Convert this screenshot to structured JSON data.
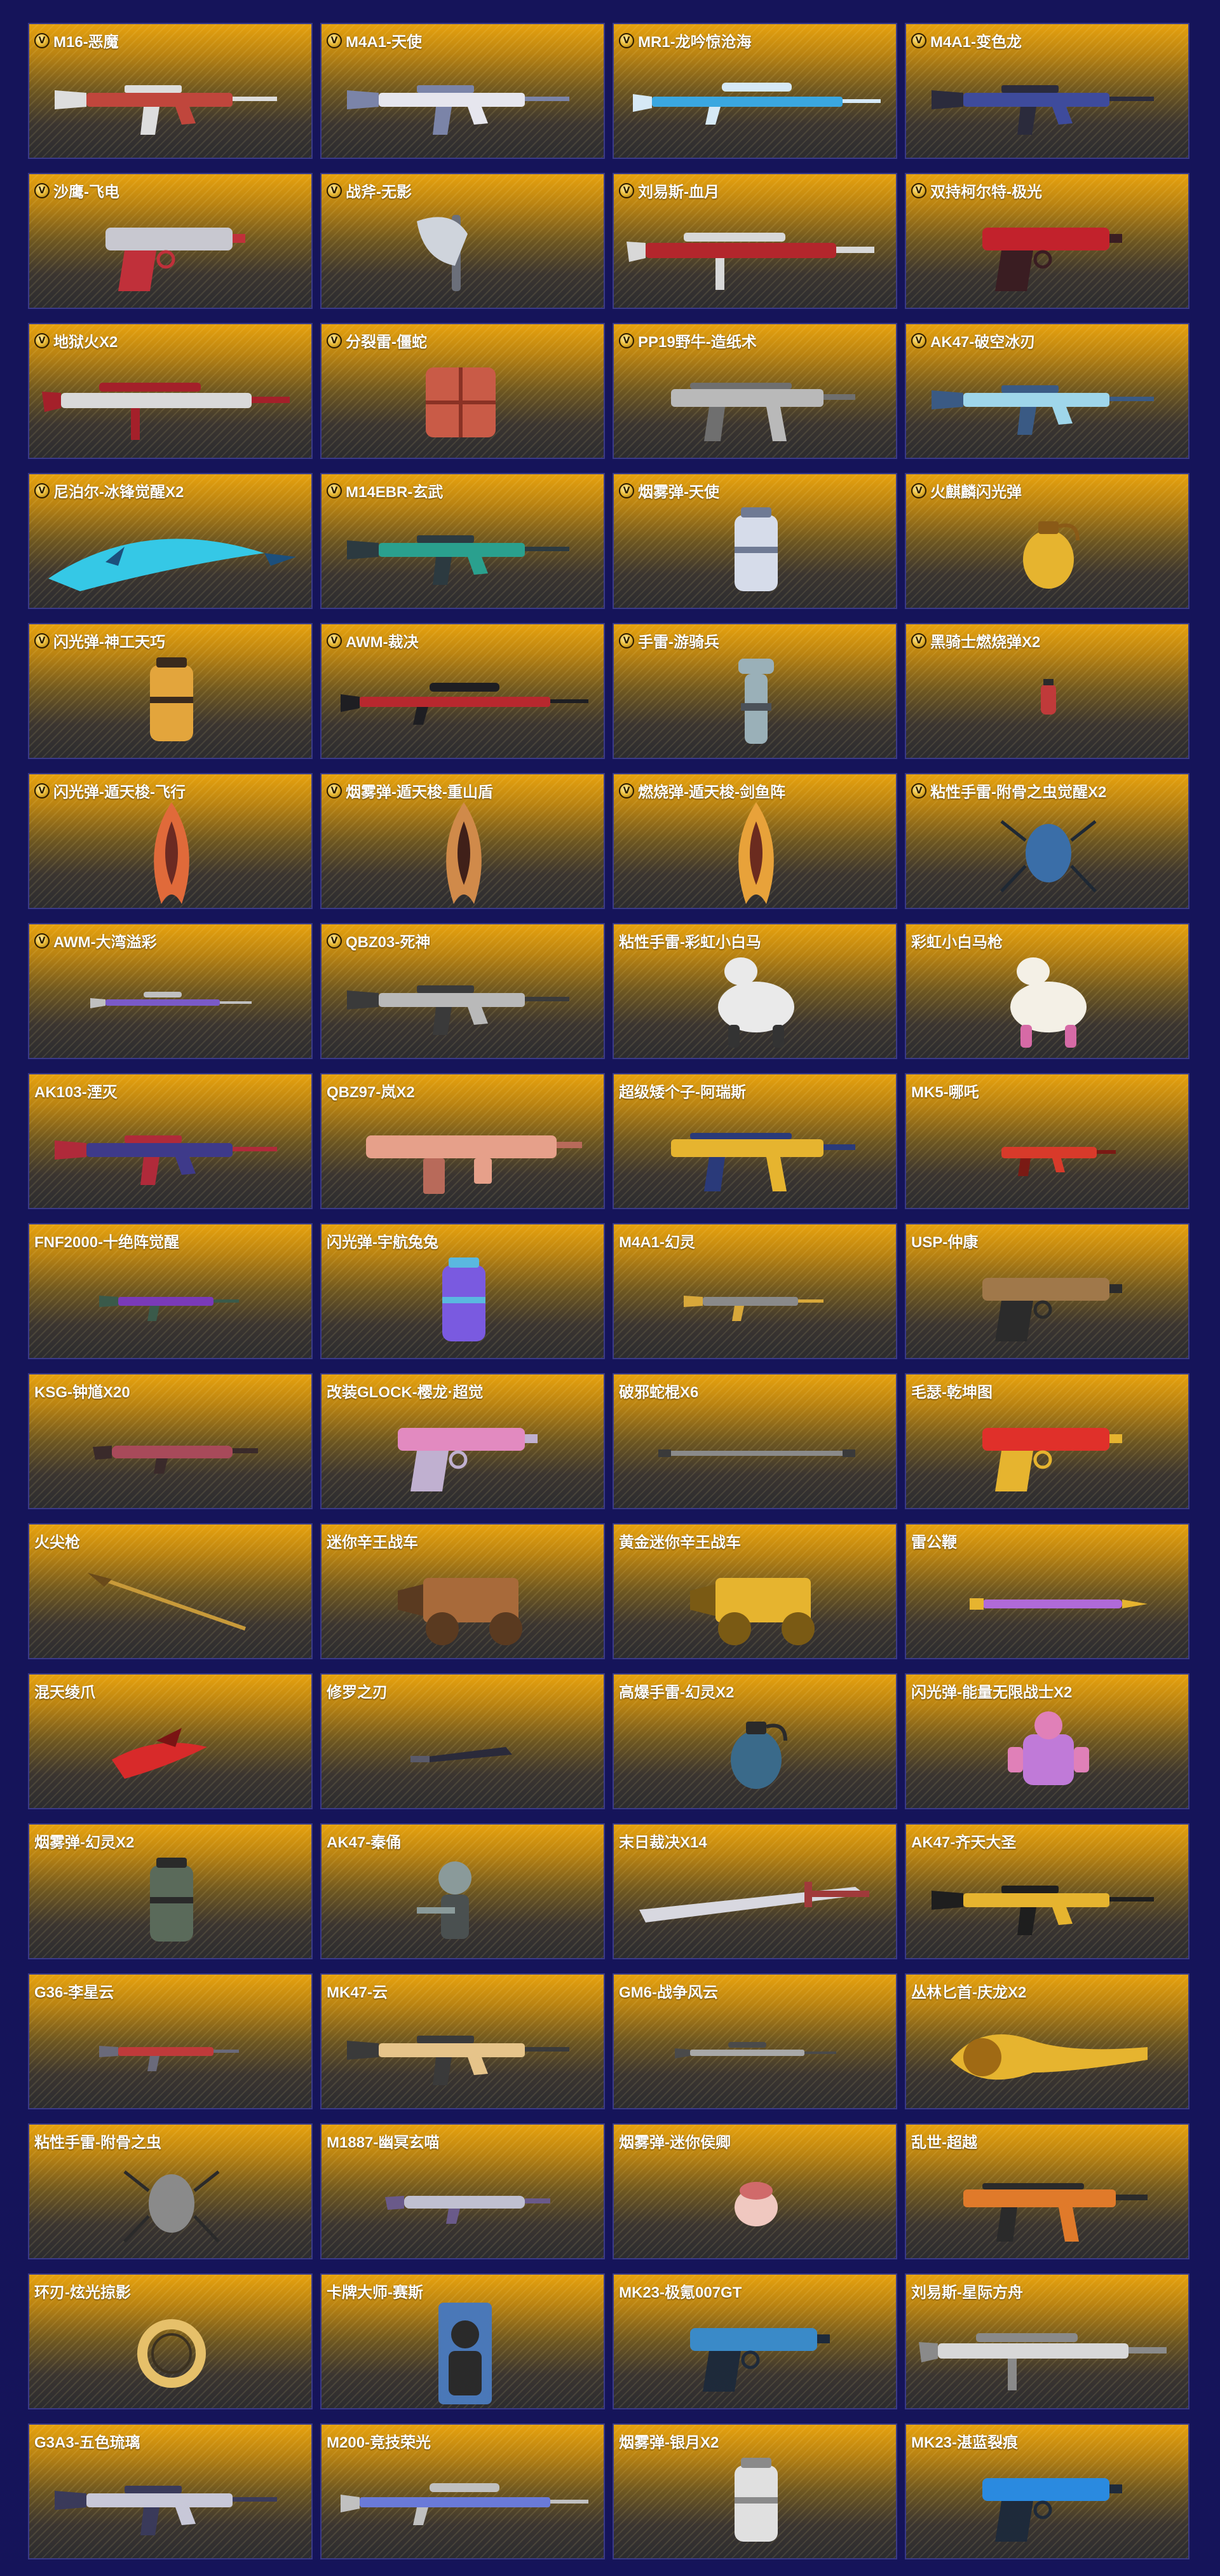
{
  "colors": {
    "page_background": "#15145a",
    "card_gold": "#e7a20e",
    "card_dark": "#2c2c2f"
  },
  "badge_glyph": "V",
  "items": [
    {
      "name": "M16-恶魔",
      "badge": true,
      "icon": "rifle-icon",
      "colors": [
        "#c0463c",
        "#ddd"
      ]
    },
    {
      "name": "M4A1-天使",
      "badge": true,
      "icon": "rifle-icon",
      "colors": [
        "#e6e6ee",
        "#7b84a8"
      ]
    },
    {
      "name": "MR1-龙吟惊沧海",
      "badge": true,
      "icon": "sniper-icon",
      "colors": [
        "#3aa7e0",
        "#d6e9f6"
      ]
    },
    {
      "name": "M4A1-变色龙",
      "badge": true,
      "icon": "rifle-icon",
      "colors": [
        "#3e4b9c",
        "#2b2b3c"
      ]
    },
    {
      "name": "沙鹰-飞电",
      "badge": true,
      "icon": "pistol-icon",
      "colors": [
        "#c8c8d0",
        "#c0303a"
      ]
    },
    {
      "name": "战斧-无影",
      "badge": true,
      "icon": "axe-icon",
      "colors": [
        "#cfd4dc",
        "#6b6f7a"
      ]
    },
    {
      "name": "刘易斯-血月",
      "badge": true,
      "icon": "machinegun-icon",
      "colors": [
        "#b3262c",
        "#d8d8d8"
      ]
    },
    {
      "name": "双持柯尔特-极光",
      "badge": true,
      "icon": "pistol-icon",
      "colors": [
        "#c2222c",
        "#3a1d22"
      ]
    },
    {
      "name": "地狱火X2",
      "badge": true,
      "icon": "machinegun-icon",
      "colors": [
        "#d9d9d9",
        "#a4202a"
      ]
    },
    {
      "name": "分裂雷-僵蛇",
      "badge": true,
      "icon": "mine-icon",
      "colors": [
        "#c95b47",
        "#8a3225"
      ]
    },
    {
      "name": "PP19野牛-造纸术",
      "badge": true,
      "icon": "smg-icon",
      "colors": [
        "#b9b9b9",
        "#6f6f6f"
      ]
    },
    {
      "name": "AK47-破空冰刃",
      "badge": true,
      "icon": "rifle-icon",
      "colors": [
        "#9fd6ea",
        "#3a5a84"
      ]
    },
    {
      "name": "尼泊尔-冰锋觉醒X2",
      "badge": true,
      "icon": "blade-icon",
      "colors": [
        "#35c8e6",
        "#1c4f7c"
      ]
    },
    {
      "name": "M14EBR-玄武",
      "badge": true,
      "icon": "rifle-icon",
      "colors": [
        "#2aa08e",
        "#2c3a40"
      ]
    },
    {
      "name": "烟雾弹-天使",
      "badge": true,
      "icon": "canister-icon",
      "colors": [
        "#d6dcea",
        "#6f7a94"
      ]
    },
    {
      "name": "火麒麟闪光弹",
      "badge": true,
      "icon": "grenade-icon",
      "colors": [
        "#e6b42f",
        "#8a5a17"
      ]
    },
    {
      "name": "闪光弹-神工天巧",
      "badge": true,
      "icon": "canister-icon",
      "colors": [
        "#e3a53c",
        "#3a2a1d"
      ]
    },
    {
      "name": "AWM-裁决",
      "badge": true,
      "icon": "sniper-icon",
      "colors": [
        "#b8282e",
        "#1e1e22"
      ]
    },
    {
      "name": "手雷-游骑兵",
      "badge": true,
      "icon": "totem-icon",
      "colors": [
        "#9ab0b8",
        "#4b5158"
      ]
    },
    {
      "name": "黑骑士燃烧弹X2",
      "badge": true,
      "icon": "grenade-small-icon",
      "colors": [
        "#c03a3a",
        "#2b2b2b"
      ]
    },
    {
      "name": "闪光弹-遁天梭-飞行",
      "badge": true,
      "icon": "shard-icon",
      "colors": [
        "#e06a3a",
        "#6b2a22"
      ]
    },
    {
      "name": "烟雾弹-遁天梭-重山盾",
      "badge": true,
      "icon": "shard-icon",
      "colors": [
        "#d08a4a",
        "#402019"
      ]
    },
    {
      "name": "燃烧弹-遁天梭-剑鱼阵",
      "badge": true,
      "icon": "shard-icon",
      "colors": [
        "#e8a23a",
        "#6b2b1f"
      ]
    },
    {
      "name": "粘性手雷-附骨之虫觉醒X2",
      "badge": true,
      "icon": "bug-icon",
      "colors": [
        "#3a6ea8",
        "#1e2834"
      ]
    },
    {
      "name": "AWM-大湾溢彩",
      "badge": true,
      "icon": "sniper-small-icon",
      "colors": [
        "#7a5ac8",
        "#c0c0c0"
      ]
    },
    {
      "name": "QBZ03-死神",
      "badge": true,
      "icon": "rifle-icon",
      "colors": [
        "#b9b9b9",
        "#3a3a3a"
      ]
    },
    {
      "name": "粘性手雷-彩虹小白马",
      "badge": false,
      "icon": "horse-icon",
      "colors": [
        "#eaeaea",
        "#333"
      ]
    },
    {
      "name": "彩虹小白马枪",
      "badge": false,
      "icon": "horse-icon",
      "colors": [
        "#f4f0e6",
        "#d66aa6"
      ]
    },
    {
      "name": "AK103-湮灭",
      "badge": false,
      "icon": "rifle-icon",
      "colors": [
        "#3e3a8a",
        "#b02a3a"
      ]
    },
    {
      "name": "QBZ97-岚X2",
      "badge": false,
      "icon": "bullpup-icon",
      "colors": [
        "#e6a08a",
        "#b86a5a"
      ]
    },
    {
      "name": "超级矮个子-阿瑞斯",
      "badge": false,
      "icon": "smg-icon",
      "colors": [
        "#e6b42f",
        "#2a3a7a"
      ]
    },
    {
      "name": "MK5-哪吒",
      "badge": false,
      "icon": "smg-small-icon",
      "colors": [
        "#d83a2a",
        "#7a1a14"
      ]
    },
    {
      "name": "FNF2000-十绝阵觉醒",
      "badge": false,
      "icon": "rifle-small-icon",
      "colors": [
        "#7a3ab8",
        "#3a5a4a"
      ]
    },
    {
      "name": "闪光弹-宇航兔兔",
      "badge": false,
      "icon": "canister-icon",
      "colors": [
        "#7a5ae0",
        "#5ab8e0"
      ]
    },
    {
      "name": "M4A1-幻灵",
      "badge": false,
      "icon": "rifle-small-icon",
      "colors": [
        "#8a8a8a",
        "#d8a83a"
      ]
    },
    {
      "name": "USP-仲康",
      "badge": false,
      "icon": "pistol-icon",
      "colors": [
        "#a0784a",
        "#2b2b2b"
      ]
    },
    {
      "name": "KSG-钟馗X20",
      "badge": false,
      "icon": "shotgun-icon",
      "colors": [
        "#a84a5a",
        "#3a2a2a"
      ]
    },
    {
      "name": "改装GLOCK-樱龙·超觉",
      "badge": false,
      "icon": "pistol-icon",
      "colors": [
        "#e28ac0",
        "#c0b0d0"
      ]
    },
    {
      "name": "破邪蛇棍X6",
      "badge": false,
      "icon": "staff-icon",
      "colors": [
        "#8a8a8a",
        "#3a3a3a"
      ]
    },
    {
      "name": "毛瑟-乾坤图",
      "badge": false,
      "icon": "pistol-icon",
      "colors": [
        "#e0302a",
        "#e6b42f"
      ]
    },
    {
      "name": "火尖枪",
      "badge": false,
      "icon": "spear-icon",
      "colors": [
        "#c89a3a",
        "#6a4a1a"
      ]
    },
    {
      "name": "迷你辛王战车",
      "badge": false,
      "icon": "chariot-icon",
      "colors": [
        "#a86a3a",
        "#5a3a20"
      ]
    },
    {
      "name": "黄金迷你辛王战车",
      "badge": false,
      "icon": "chariot-icon",
      "colors": [
        "#e6b42f",
        "#7a5a14"
      ]
    },
    {
      "name": "雷公鞭",
      "badge": false,
      "icon": "whip-icon",
      "colors": [
        "#b06ad8",
        "#e6b42f"
      ]
    },
    {
      "name": "混天绫爪",
      "badge": false,
      "icon": "claw-icon",
      "colors": [
        "#d82a2a",
        "#7a1414"
      ]
    },
    {
      "name": "修罗之刃",
      "badge": false,
      "icon": "knife-icon",
      "colors": [
        "#2a2a3a",
        "#5a5a6a"
      ]
    },
    {
      "name": "高爆手雷-幻灵X2",
      "badge": false,
      "icon": "grenade-icon",
      "colors": [
        "#3a6a8a",
        "#2a2a2a"
      ]
    },
    {
      "name": "闪光弹-能量无限战士X2",
      "badge": false,
      "icon": "mech-icon",
      "colors": [
        "#c07ad8",
        "#e080b8"
      ]
    },
    {
      "name": "烟雾弹-幻灵X2",
      "badge": false,
      "icon": "canister-icon",
      "colors": [
        "#5a6a5a",
        "#2a2a2a"
      ]
    },
    {
      "name": "AK47-秦俑",
      "badge": false,
      "icon": "warrior-icon",
      "colors": [
        "#8a9a9a",
        "#4a5050"
      ]
    },
    {
      "name": "末日裁决X14",
      "badge": false,
      "icon": "greatsword-icon",
      "colors": [
        "#d8d8e0",
        "#a03a3a"
      ]
    },
    {
      "name": "AK47-齐天大圣",
      "badge": false,
      "icon": "rifle-icon",
      "colors": [
        "#e6b42f",
        "#1e1e1e"
      ]
    },
    {
      "name": "G36-李星云",
      "badge": false,
      "icon": "rifle-small-icon",
      "colors": [
        "#c03a3a",
        "#6a6a7a"
      ]
    },
    {
      "name": "MK47-云",
      "badge": false,
      "icon": "rifle-icon",
      "colors": [
        "#e6c48a",
        "#3a3a3a"
      ]
    },
    {
      "name": "GM6-战争风云",
      "badge": false,
      "icon": "sniper-small-icon",
      "colors": [
        "#a8a8a8",
        "#4a4a4a"
      ]
    },
    {
      "name": "丛林匕首-庆龙X2",
      "badge": false,
      "icon": "dragon-blade-icon",
      "colors": [
        "#e6b42f",
        "#a06a14"
      ]
    },
    {
      "name": "粘性手雷-附骨之虫",
      "badge": false,
      "icon": "bug-icon",
      "colors": [
        "#8a8a8a",
        "#2a2a2a"
      ]
    },
    {
      "name": "M1887-幽冥玄喵",
      "badge": false,
      "icon": "shotgun-icon",
      "colors": [
        "#c0c0d0",
        "#6a5a8a"
      ]
    },
    {
      "name": "烟雾弹-迷你侯卿",
      "badge": false,
      "icon": "head-icon",
      "colors": [
        "#f0c8c0",
        "#d06a6a"
      ]
    },
    {
      "name": "乱世-超越",
      "badge": false,
      "icon": "smg-icon",
      "colors": [
        "#e07a2a",
        "#2a2a2a"
      ]
    },
    {
      "name": "环刃-炫光掠影",
      "badge": false,
      "icon": "ring-icon",
      "colors": [
        "#e6c06a",
        "#3a3020"
      ]
    },
    {
      "name": "卡牌大师-赛斯",
      "badge": false,
      "icon": "card-icon",
      "colors": [
        "#4a78b8",
        "#2a2a2a"
      ]
    },
    {
      "name": "MK23-极氪007GT",
      "badge": false,
      "icon": "pistol-icon",
      "colors": [
        "#3a8ac8",
        "#1e2a3a"
      ]
    },
    {
      "name": "刘易斯-星际方舟",
      "badge": false,
      "icon": "machinegun-icon",
      "colors": [
        "#d8d8d8",
        "#8a8a8a"
      ]
    },
    {
      "name": "G3A3-五色琉璃",
      "badge": false,
      "icon": "rifle-icon",
      "colors": [
        "#c8c8d8",
        "#3a3a5a"
      ]
    },
    {
      "name": "M200-竞技荣光",
      "badge": false,
      "icon": "sniper-icon",
      "colors": [
        "#6a7ad8",
        "#c0c0c0"
      ]
    },
    {
      "name": "烟雾弹-银月X2",
      "badge": false,
      "icon": "canister-icon",
      "colors": [
        "#e0e0e0",
        "#8a8a8a"
      ]
    },
    {
      "name": "MK23-湛蓝裂痕",
      "badge": false,
      "icon": "pistol-icon",
      "colors": [
        "#2a8ae0",
        "#1e2a3a"
      ]
    }
  ]
}
